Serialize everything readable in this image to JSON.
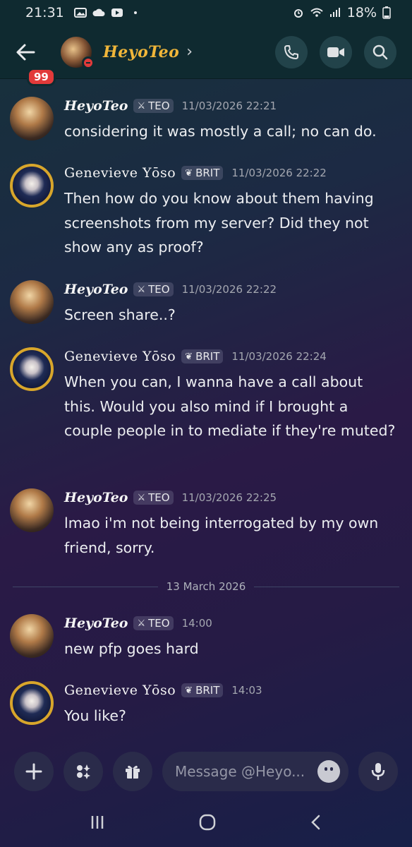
{
  "status_bar": {
    "time": "21:31",
    "battery": "18%",
    "left_icons": [
      "image-icon",
      "cloud-icon",
      "youtube-icon",
      "dot-icon"
    ],
    "right_icons": [
      "alarm-icon",
      "wifi-icon",
      "signal-icon",
      "battery-icon"
    ]
  },
  "header": {
    "unread_badge": "99",
    "title": "HeyoTeo",
    "chevron": "›",
    "actions": [
      "call-icon",
      "video-icon",
      "search-icon"
    ]
  },
  "messages": [
    {
      "user": "HeyoTeo",
      "tag": "TEO",
      "time": "11/03/2026 22:21",
      "text": "considering it was mostly a call; no can do."
    },
    {
      "user": "Genevieve Yōso",
      "tag": "BRIT",
      "time": "11/03/2026 22:22",
      "text": "Then how do you know about them having screenshots from my server? Did they not show any as proof?"
    },
    {
      "user": "HeyoTeo",
      "tag": "TEO",
      "time": "11/03/2026 22:22",
      "text": "Screen share..?"
    },
    {
      "user": "Genevieve Yōso",
      "tag": "BRIT",
      "time": "11/03/2026 22:24",
      "text": "When you can, I wanna have a call about this. Would you also mind if I brought a couple people in to mediate if they're muted?"
    },
    {
      "user": "HeyoTeo",
      "tag": "TEO",
      "time": "11/03/2026 22:25",
      "text": "lmao i'm not being interrogated by my own friend, sorry."
    },
    {
      "user": "HeyoTeo",
      "tag": "TEO",
      "time": "14:00",
      "text": "new pfp goes hard"
    },
    {
      "user": "Genevieve Yōso",
      "tag": "BRIT",
      "time": "14:03",
      "text": "You like?"
    }
  ],
  "date_divider": "13 March 2026",
  "composer": {
    "placeholder": "Message @Heyo...",
    "buttons": [
      "plus-icon",
      "apps-icon",
      "gift-icon",
      "emoji-icon",
      "microphone-icon"
    ]
  },
  "navbar": [
    "recents-icon",
    "home-icon",
    "back-nav-icon"
  ],
  "colors": {
    "header_bg": "#0f2a30",
    "title_gold": "#f0b63a",
    "badge_red": "#e23a3a",
    "composer_btn": "#2a2b4a"
  }
}
